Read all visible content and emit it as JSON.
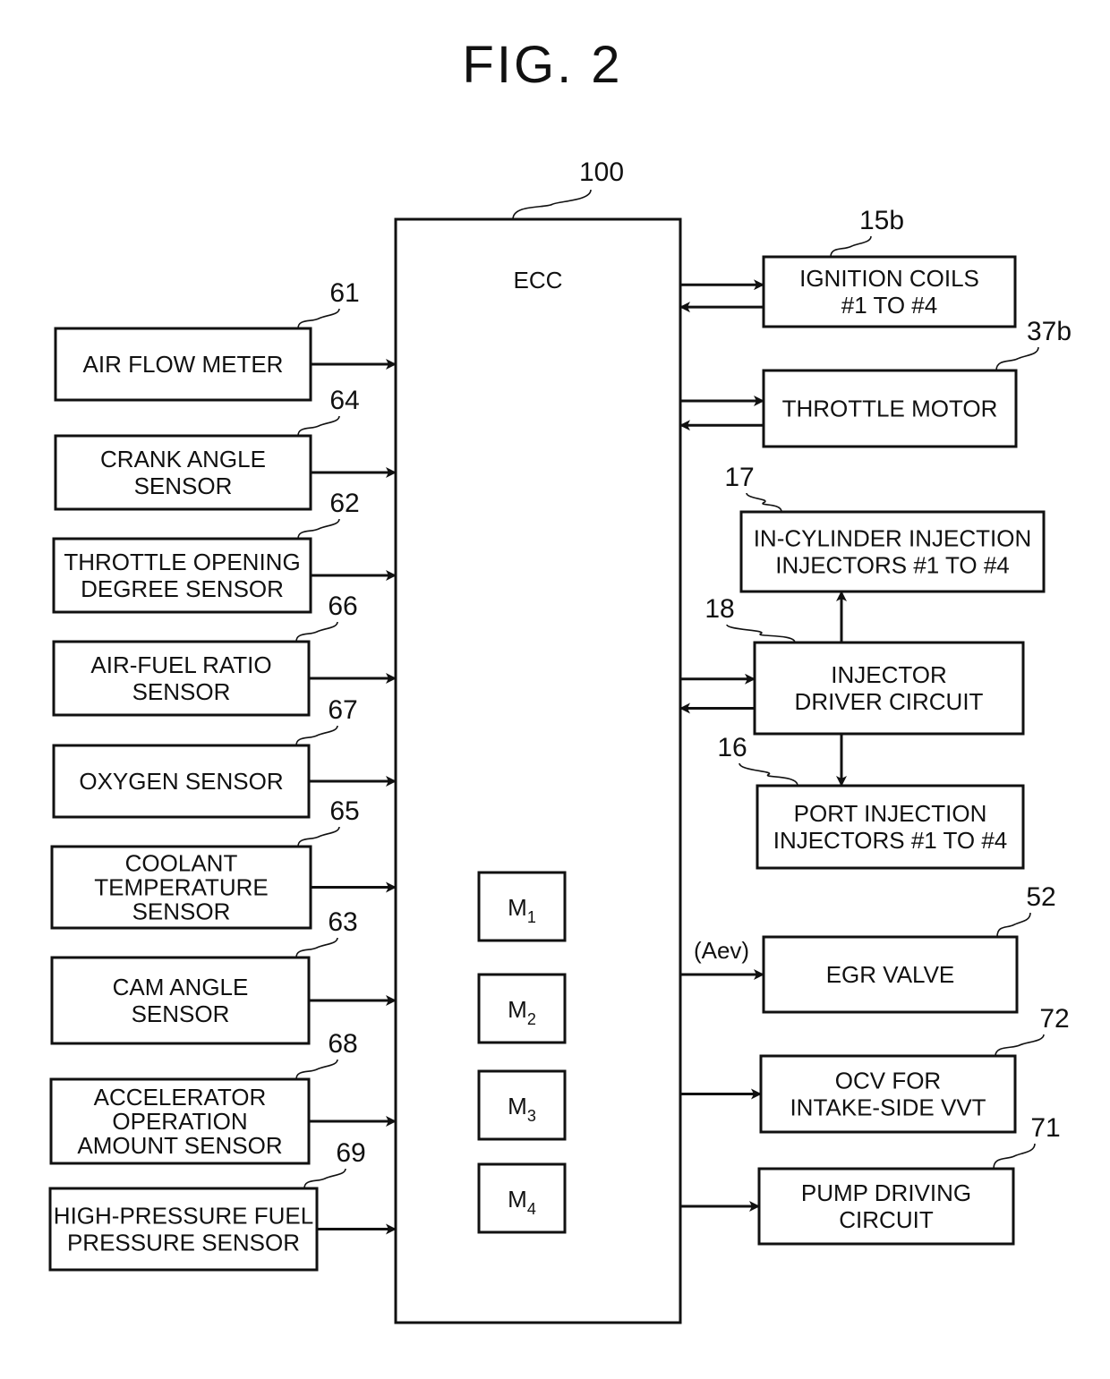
{
  "figure_title": "FIG. 2",
  "ecu": {
    "ref": "100",
    "label": "ECC"
  },
  "memories": [
    {
      "label": "M",
      "sub": "1"
    },
    {
      "label": "M",
      "sub": "2"
    },
    {
      "label": "M",
      "sub": "3"
    },
    {
      "label": "M",
      "sub": "4"
    }
  ],
  "inputs": [
    {
      "ref": "61",
      "lines": [
        "AIR FLOW METER"
      ]
    },
    {
      "ref": "64",
      "lines": [
        "CRANK ANGLE",
        "SENSOR"
      ]
    },
    {
      "ref": "62",
      "lines": [
        "THROTTLE OPENING",
        "DEGREE SENSOR"
      ]
    },
    {
      "ref": "66",
      "lines": [
        "AIR-FUEL RATIO",
        "SENSOR"
      ]
    },
    {
      "ref": "67",
      "lines": [
        "OXYGEN SENSOR"
      ]
    },
    {
      "ref": "65",
      "lines": [
        "COOLANT",
        "TEMPERATURE",
        "SENSOR"
      ]
    },
    {
      "ref": "63",
      "lines": [
        "CAM ANGLE",
        "SENSOR"
      ]
    },
    {
      "ref": "68",
      "lines": [
        "ACCELERATOR",
        "OPERATION",
        "AMOUNT SENSOR"
      ]
    },
    {
      "ref": "69",
      "lines": [
        "HIGH-PRESSURE FUEL",
        "PRESSURE SENSOR"
      ]
    }
  ],
  "outputs": [
    {
      "ref": "15b",
      "lines": [
        "IGNITION COILS",
        "#1 TO #4"
      ],
      "bidirectional": true
    },
    {
      "ref": "37b",
      "lines": [
        "THROTTLE MOTOR"
      ],
      "bidirectional": true
    },
    {
      "ref": "17",
      "lines": [
        "IN-CYLINDER INJECTION",
        "INJECTORS #1 TO #4"
      ],
      "bidirectional": false
    },
    {
      "ref": "18",
      "lines": [
        "INJECTOR",
        "DRIVER CIRCUIT"
      ],
      "bidirectional": true
    },
    {
      "ref": "16",
      "lines": [
        "PORT INJECTION",
        "INJECTORS #1 TO #4"
      ],
      "bidirectional": false
    },
    {
      "ref": "52",
      "lines": [
        "EGR VALVE"
      ],
      "bidirectional": false,
      "signal_label": "(Aev)"
    },
    {
      "ref": "72",
      "lines": [
        "OCV FOR",
        "INTAKE-SIDE VVT"
      ],
      "bidirectional": false
    },
    {
      "ref": "71",
      "lines": [
        "PUMP DRIVING",
        "CIRCUIT"
      ],
      "bidirectional": false
    }
  ]
}
